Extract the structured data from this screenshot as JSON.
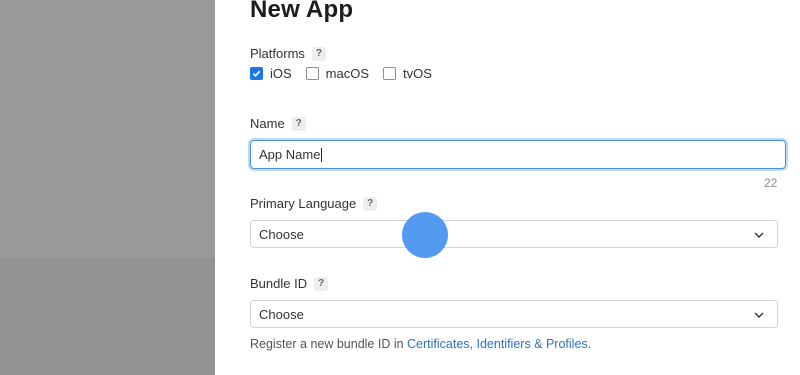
{
  "dialog": {
    "title": "New App"
  },
  "platforms": {
    "label": "Platforms",
    "help": "?",
    "options": [
      {
        "label": "iOS",
        "checked": true
      },
      {
        "label": "macOS",
        "checked": false
      },
      {
        "label": "tvOS",
        "checked": false
      }
    ]
  },
  "name": {
    "label": "Name",
    "help": "?",
    "value": "App Name",
    "remaining": "22"
  },
  "primary_language": {
    "label": "Primary Language",
    "help": "?",
    "selected": "Choose"
  },
  "bundle_id": {
    "label": "Bundle ID",
    "help": "?",
    "selected": "Choose",
    "hint_prefix": "Register a new bundle ID in ",
    "hint_link": "Certificates, Identifiers & Profiles",
    "hint_suffix": "."
  },
  "colors": {
    "accent": "#1c77e5",
    "link": "#2a74bf",
    "pointer": "#4a96f0"
  }
}
